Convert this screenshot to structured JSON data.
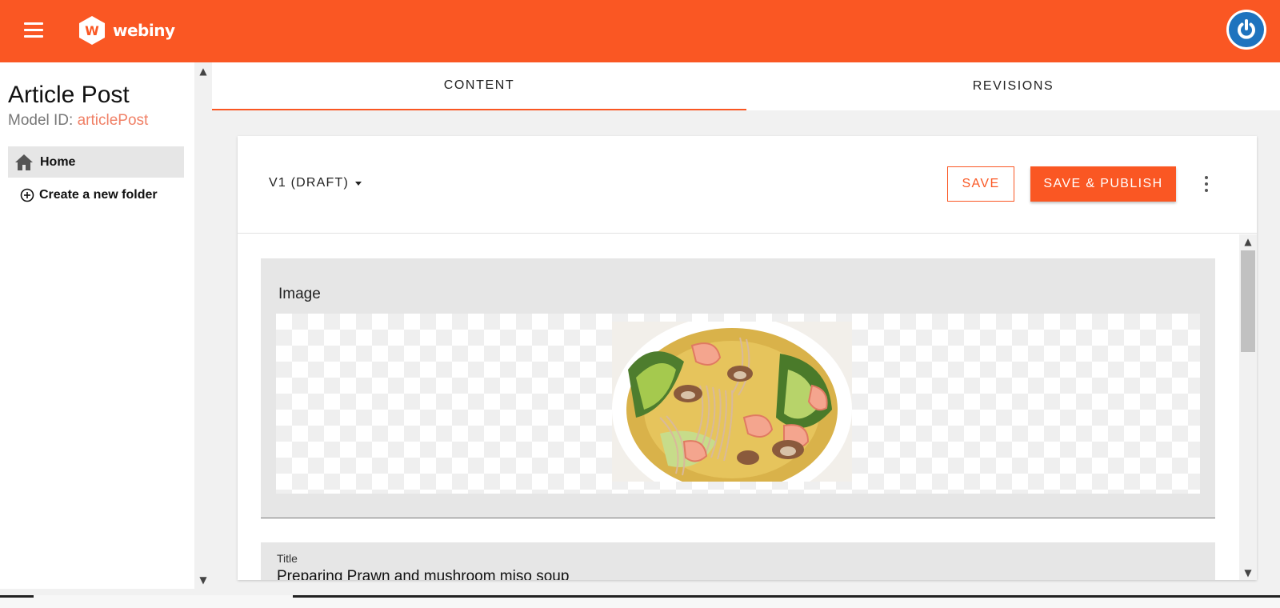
{
  "colors": {
    "brand": "#fa5723",
    "model_id_accent": "#f08066",
    "avatar_blue": "#1e73be"
  },
  "header": {
    "logo_text": "webiny",
    "menu_icon": "hamburger-icon",
    "user_icon": "power-icon"
  },
  "sidebar": {
    "title": "Article Post",
    "model_id_label": "Model ID:",
    "model_id_value": "articlePost",
    "home_label": "Home",
    "home_icon": "home-icon",
    "new_folder_label": "Create a new folder",
    "new_folder_icon": "add-circle-icon"
  },
  "tabs": [
    {
      "label": "CONTENT",
      "active": true
    },
    {
      "label": "REVISIONS",
      "active": false
    }
  ],
  "editor": {
    "version_label": "V1 (DRAFT)",
    "save_label": "SAVE",
    "publish_label": "SAVE & PUBLISH",
    "more_icon": "more-vertical-icon",
    "image_field_label": "Image",
    "image_alt": "Prawn and mushroom miso soup bowl",
    "title_field_label": "Title",
    "title_field_value": "Preparing Prawn and mushroom miso soup"
  }
}
